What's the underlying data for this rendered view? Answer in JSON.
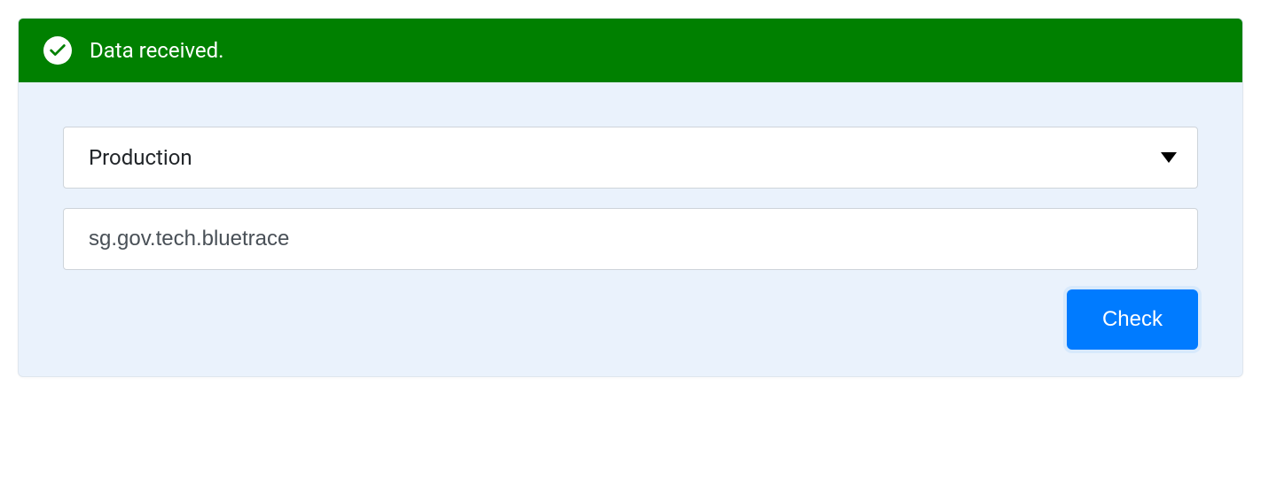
{
  "alert": {
    "message": "Data received."
  },
  "form": {
    "environment_select": {
      "value": "Production"
    },
    "package_input": {
      "value": "sg.gov.tech.bluetrace"
    },
    "check_button_label": "Check"
  },
  "colors": {
    "alert_bg": "#008000",
    "card_bg": "#eaf2fc",
    "primary": "#007bff"
  }
}
